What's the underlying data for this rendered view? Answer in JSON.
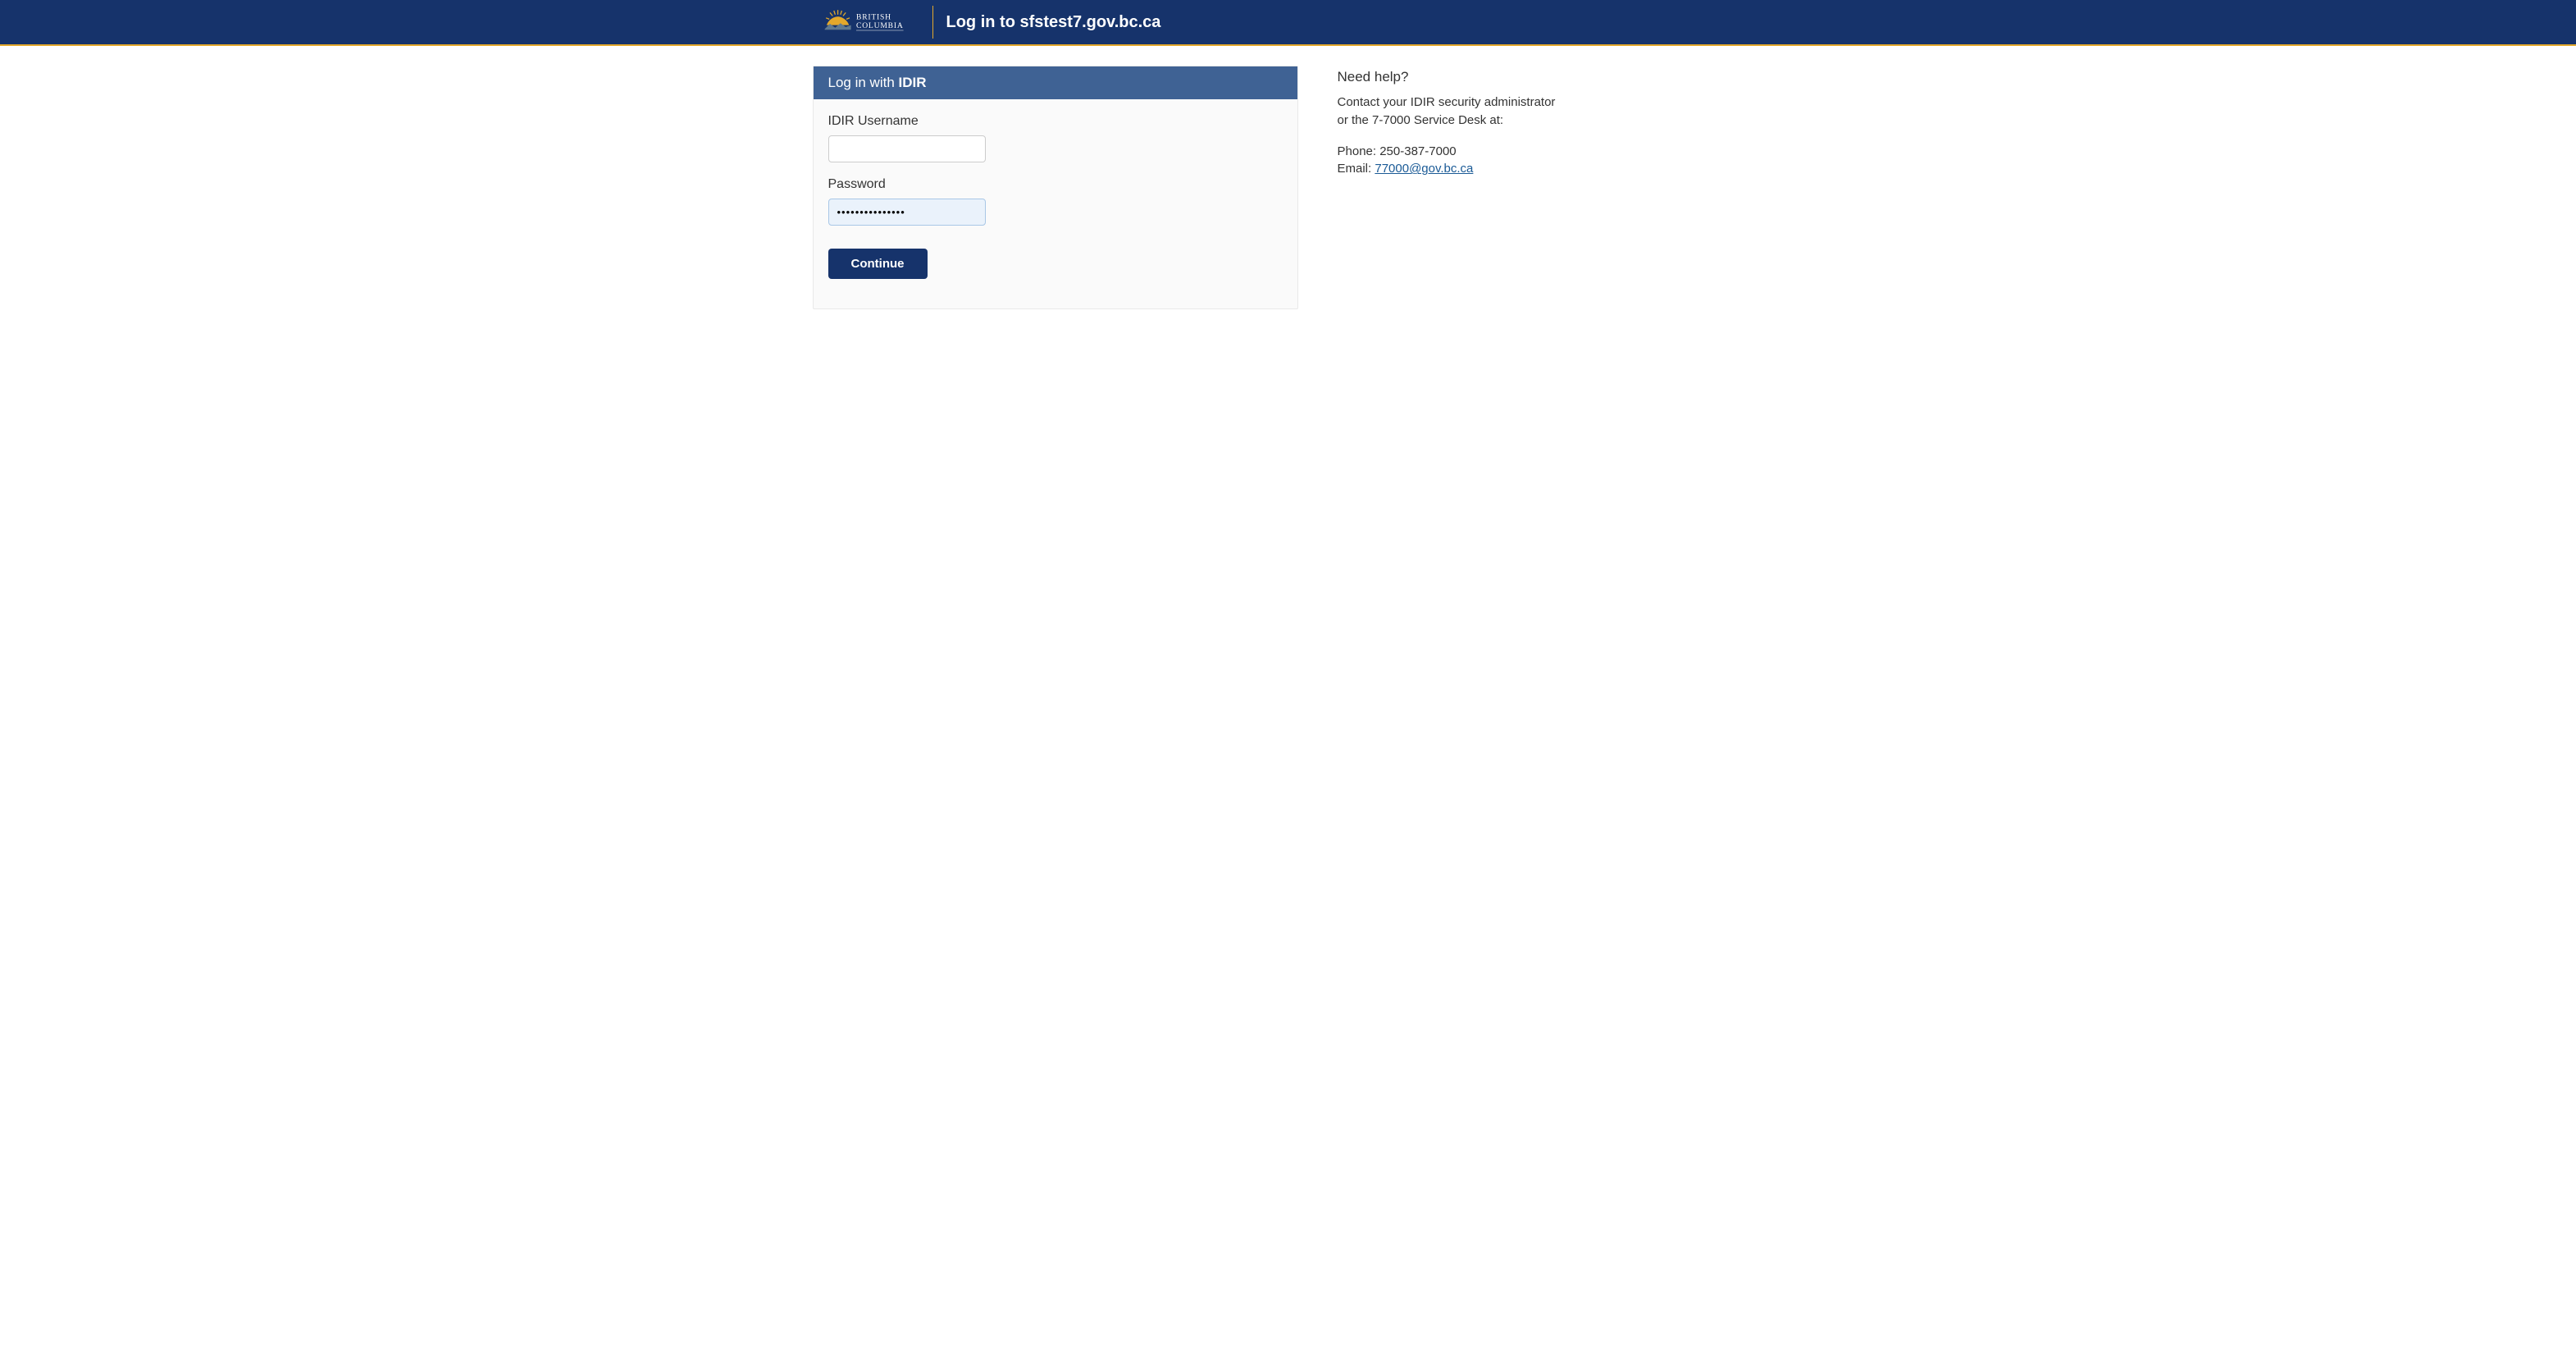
{
  "header": {
    "logo_text_top": "BRITISH",
    "logo_text_bottom": "COLUMBIA",
    "title": "Log in to sfstest7.gov.bc.ca"
  },
  "login": {
    "panel_title_prefix": "Log in with",
    "panel_title_idir": "IDIR",
    "username_label": "IDIR Username",
    "username_value": "",
    "password_label": "Password",
    "password_value": "•••••••••••••••",
    "continue_label": "Continue"
  },
  "help": {
    "title": "Need help?",
    "text_line1": "Contact your IDIR security administrator",
    "text_line2": "or the 7-7000 Service Desk at:",
    "phone_label": "Phone:",
    "phone_value": "250-387-7000",
    "email_label": "Email:",
    "email_link_text": "77000@gov.bc.ca"
  },
  "colors": {
    "header_bg": "#16336b",
    "header_border": "#e3a82b",
    "panel_header_bg": "#3f6294",
    "link": "#1a5a96"
  }
}
